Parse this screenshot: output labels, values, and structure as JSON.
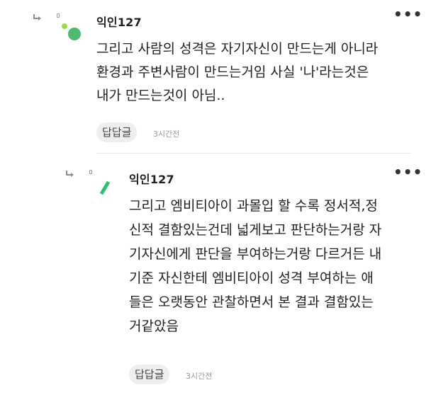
{
  "comments": [
    {
      "username": "익인127",
      "more_label": "•••",
      "lines": [
        "그리고 사람의 성격은 자기자신이 만드는게 아니라",
        "환경과 주변사람이 만드는거임 사실 '나'라는것은",
        "내가 만드는것이 아님.."
      ],
      "reply_label": "답답글",
      "time": "3시간전",
      "avatar_colors": [
        "#9ad94a",
        "#4fba6f"
      ]
    },
    {
      "username": "익인127",
      "more_label": "•••",
      "lines": [
        "그리고 엠비티아이 과몰입 할 수록 정서적,정",
        "신적 결함있는건데 넓게보고 판단하는거랑 자",
        "기자신에게 판단을 부여하는거랑 다르거든 내",
        "기준 자신한테 엠비티아이 성격 부여하는 애",
        "들은 오랫동안 관찰하면서 본 결과 결함있는",
        "거같았음"
      ],
      "reply_label": "답답글",
      "time": "3시간전",
      "avatar_colors": [
        "#2fbf71"
      ]
    }
  ]
}
